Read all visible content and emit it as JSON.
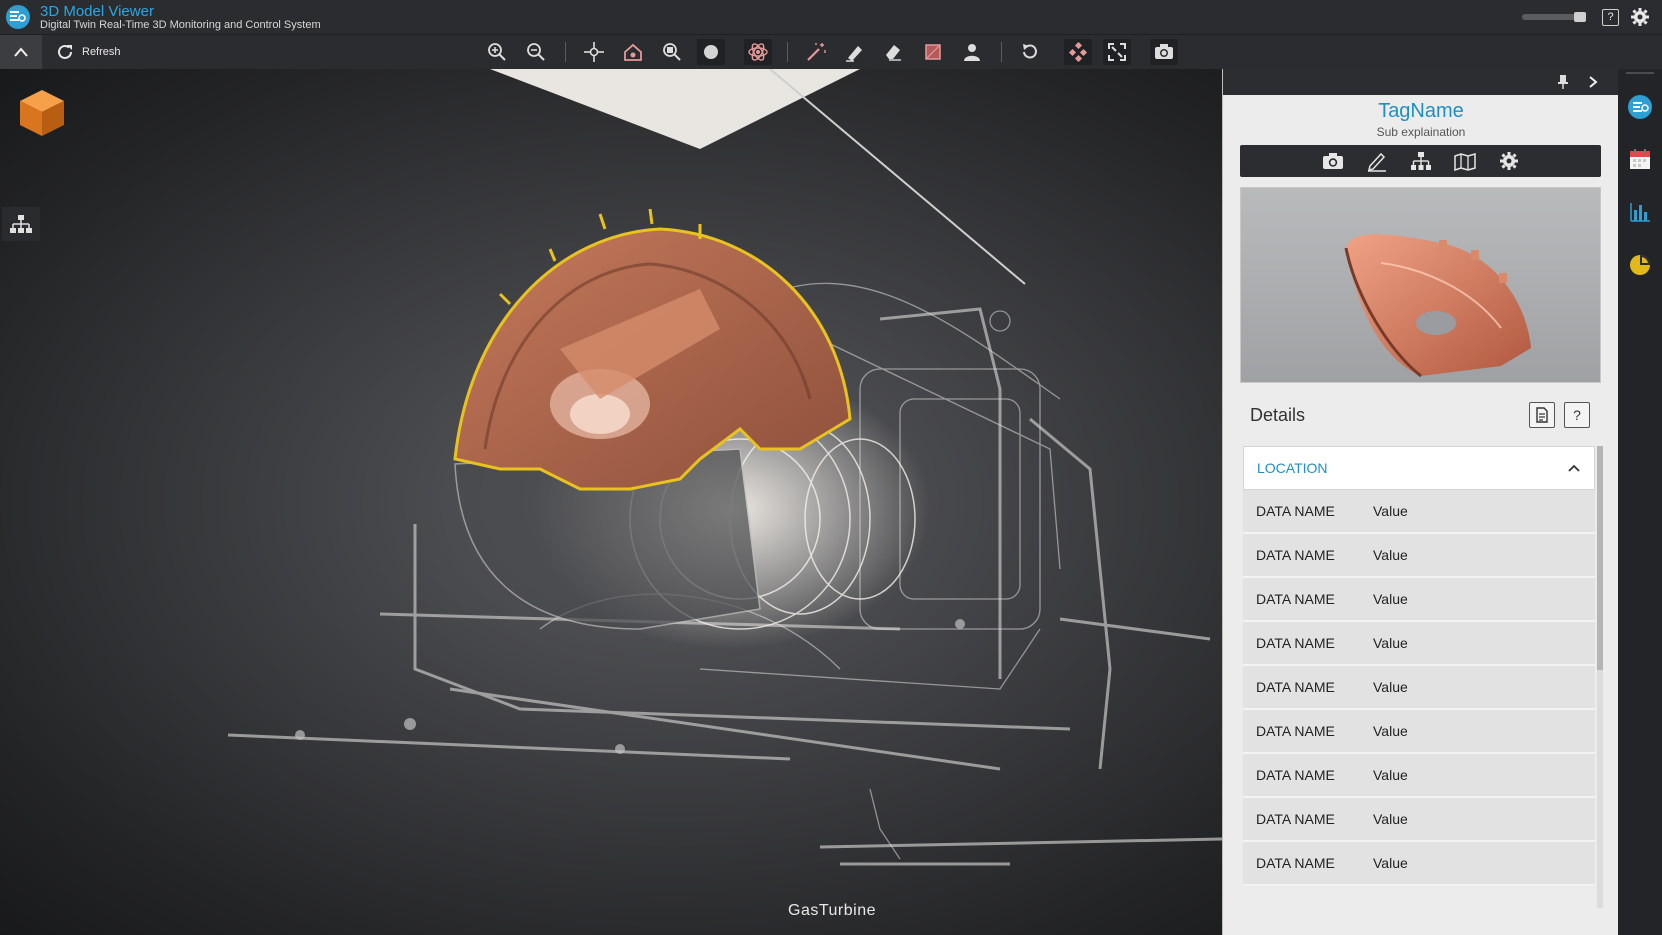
{
  "app": {
    "title": "3D Model Viewer",
    "subtitle": "Digital Twin Real-Time 3D Monitoring and Control System"
  },
  "header": {
    "help_label": "?"
  },
  "toolbar": {
    "refresh_label": "Refresh",
    "tools": [
      "zoom-in-icon",
      "zoom-out-icon",
      "pan-icon",
      "home-view-icon",
      "zoom-fit-icon",
      "solid-mode-icon",
      "xray-icon",
      "wand-icon",
      "highlighter-icon",
      "eraser-icon",
      "section-box-icon",
      "person-icon",
      "reset-icon",
      "explode-icon",
      "fullscreen-icon",
      "screenshot-icon"
    ]
  },
  "viewport": {
    "model_label": "GasTurbine"
  },
  "panel": {
    "tag_name": "TagName",
    "sub_explanation": "Sub explaination",
    "tabs": [
      "camera-icon",
      "edit-icon",
      "hierarchy-icon",
      "map-icon",
      "gear-icon"
    ],
    "details_title": "Details",
    "help_label": "?",
    "section_title": "LOCATION",
    "rows": [
      {
        "name": "DATA NAME",
        "value": "Value"
      },
      {
        "name": "DATA NAME",
        "value": "Value"
      },
      {
        "name": "DATA NAME",
        "value": "Value"
      },
      {
        "name": "DATA NAME",
        "value": "Value"
      },
      {
        "name": "DATA NAME",
        "value": "Value"
      },
      {
        "name": "DATA NAME",
        "value": "Value"
      },
      {
        "name": "DATA NAME",
        "value": "Value"
      },
      {
        "name": "DATA NAME",
        "value": "Value"
      },
      {
        "name": "DATA NAME",
        "value": "Value"
      }
    ]
  },
  "sidebar": {
    "buttons": [
      "monitor-icon",
      "calendar-icon",
      "bar-chart-icon",
      "pie-chart-icon"
    ]
  },
  "colors": {
    "accent": "#29a7e1",
    "highlight": "#e8c21e",
    "copper": "#c97a5a",
    "brand_orange": "#e8801f"
  }
}
